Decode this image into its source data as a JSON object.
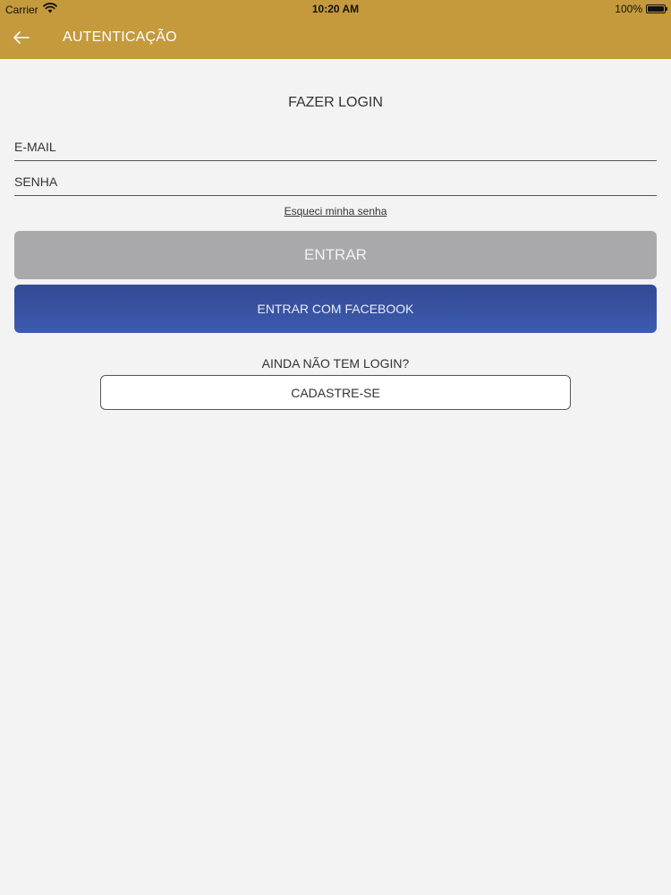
{
  "status_bar": {
    "carrier": "Carrier",
    "time": "10:20 AM",
    "battery": "100%"
  },
  "nav": {
    "title": "AUTENTICAÇÃO",
    "back_icon": "arrow-left-icon"
  },
  "login": {
    "title": "FAZER LOGIN",
    "email_placeholder": "E-MAIL",
    "email_value": "",
    "password_placeholder": "SENHA",
    "password_value": "",
    "forgot_password": "Esqueci minha senha",
    "enter_label": "ENTRAR",
    "facebook_label": "ENTRAR COM FACEBOOK"
  },
  "signup": {
    "prompt": "AINDA NÃO TEM LOGIN?",
    "button_label": "CADASTRE-SE"
  },
  "colors": {
    "header": "#c49a3d",
    "background": "#f3f3f4",
    "enter_button": "#a9a8ab",
    "facebook_button": "#3b55a6"
  }
}
